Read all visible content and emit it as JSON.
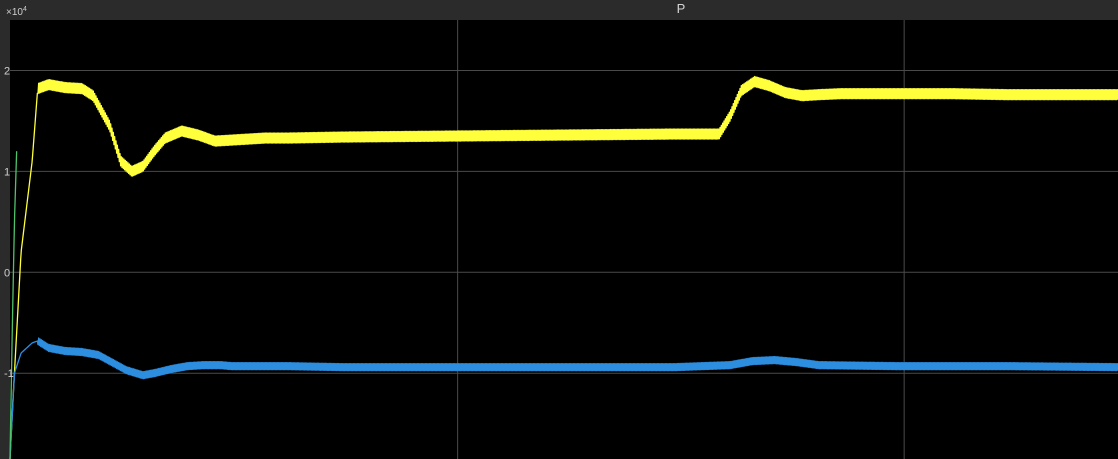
{
  "chart_data": {
    "type": "line",
    "title": "P",
    "y_multiplier": "×10",
    "y_multiplier_exp": "4",
    "ylim": [
      -1.85,
      2.5
    ],
    "xlim": [
      0,
      1
    ],
    "yticks": [
      2,
      1,
      0,
      -1
    ],
    "ytick_labels": [
      "2",
      "1",
      "0",
      "-1"
    ],
    "grid": true,
    "background": "#000000",
    "series": [
      {
        "color": "#ffff3b",
        "ripple": 0.05,
        "x": [
          0.0,
          0.003,
          0.01,
          0.02,
          0.025,
          0.035,
          0.05,
          0.065,
          0.075,
          0.09,
          0.1,
          0.11,
          0.12,
          0.13,
          0.14,
          0.155,
          0.17,
          0.185,
          0.2,
          0.215,
          0.23,
          0.25,
          0.3,
          0.4,
          0.5,
          0.6,
          0.64,
          0.65,
          0.66,
          0.672,
          0.685,
          0.7,
          0.715,
          0.73,
          0.75,
          0.8,
          0.85,
          0.9,
          1.0
        ],
        "y": [
          -1.85,
          -1.2,
          0.2,
          1.1,
          1.82,
          1.86,
          1.83,
          1.82,
          1.75,
          1.45,
          1.1,
          1.0,
          1.05,
          1.2,
          1.33,
          1.4,
          1.36,
          1.3,
          1.31,
          1.32,
          1.33,
          1.33,
          1.34,
          1.35,
          1.36,
          1.37,
          1.37,
          1.55,
          1.8,
          1.89,
          1.85,
          1.78,
          1.75,
          1.76,
          1.77,
          1.77,
          1.77,
          1.76,
          1.76
        ]
      },
      {
        "color": "#2d8ee0",
        "ripple": 0.035,
        "x": [
          0.0,
          0.004,
          0.01,
          0.02,
          0.025,
          0.035,
          0.05,
          0.065,
          0.08,
          0.09,
          0.105,
          0.12,
          0.13,
          0.145,
          0.16,
          0.175,
          0.19,
          0.2,
          0.25,
          0.3,
          0.4,
          0.5,
          0.6,
          0.65,
          0.67,
          0.69,
          0.71,
          0.73,
          0.8,
          0.9,
          1.0
        ],
        "y": [
          -1.85,
          -1.0,
          -0.8,
          -0.7,
          -0.68,
          -0.75,
          -0.78,
          -0.79,
          -0.82,
          -0.88,
          -0.97,
          -1.02,
          -1.0,
          -0.96,
          -0.93,
          -0.92,
          -0.92,
          -0.93,
          -0.93,
          -0.94,
          -0.94,
          -0.94,
          -0.94,
          -0.92,
          -0.88,
          -0.87,
          -0.89,
          -0.92,
          -0.93,
          -0.93,
          -0.94
        ]
      },
      {
        "color": "#4fc36b",
        "ripple": 0,
        "x": [
          0.0,
          0.002,
          0.004,
          0.006
        ],
        "y": [
          -1.85,
          -0.6,
          0.5,
          1.2
        ]
      }
    ]
  }
}
